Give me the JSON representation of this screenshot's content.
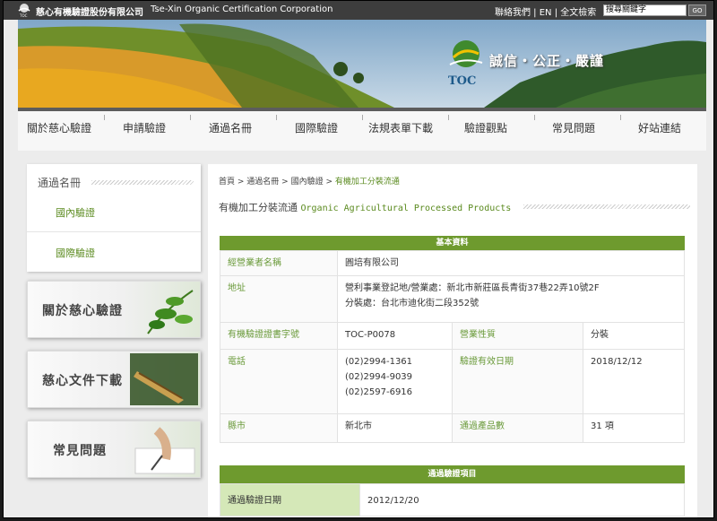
{
  "topbar": {
    "company_cn": "慈心有機驗證股份有限公司",
    "company_en": "Tse-Xin Organic Certification Corporation",
    "links": [
      "聯絡我們",
      "EN",
      "全文檢索"
    ],
    "search_placeholder": "搜尋關鍵字",
    "go_label": "GO"
  },
  "banner": {
    "slogan": "誠信・公正・嚴謹",
    "logo_text": "TOC"
  },
  "nav": {
    "items": [
      "關於慈心驗證",
      "申請驗證",
      "通過名冊",
      "國際驗證",
      "法規表單下載",
      "驗證觀點",
      "常見問題",
      "好站連結"
    ]
  },
  "sidebar": {
    "title": "通過名冊",
    "links": [
      "國內驗證",
      "國際驗證"
    ],
    "promos": [
      "關於慈心驗證",
      "慈心文件下載",
      "常見問題"
    ]
  },
  "main": {
    "breadcrumb": [
      "首頁",
      "通過名冊",
      "國內驗證",
      "有機加工分裝流通"
    ],
    "title_cn": "有機加工分裝流通",
    "title_en": "Organic Agricultural Processed Products",
    "basic_header": "基本資料",
    "operator_label": "經營業者名稱",
    "operator_value": "圓培有限公司",
    "address_label": "地址",
    "address_line1": "營利事業登記地/營業處：新北市新莊區長青街37巷22弄10號2F",
    "address_line2": "分裝處：台北市迪化街二段352號",
    "cert_no_label": "有機驗證證書字號",
    "cert_no_value": "TOC-P0078",
    "business_label": "營業性質",
    "business_value": "分裝",
    "phone_label": "電話",
    "phones": [
      "(02)2994-1361",
      "(02)2994-9039",
      "(02)2597-6916"
    ],
    "valid_label": "驗證有效日期",
    "valid_value": "2018/12/12",
    "county_label": "縣市",
    "county_value": "新北市",
    "product_count_label": "通過產品數",
    "product_count_value": "31 項",
    "pass_header": "通過驗證項目",
    "pass_date_label": "通過驗證日期",
    "pass_date_value": "2012/12/20"
  },
  "colors": {
    "accent_green": "#6e9a2e",
    "link_green": "#5a8a1e",
    "topbar": "#3d3d3d"
  }
}
